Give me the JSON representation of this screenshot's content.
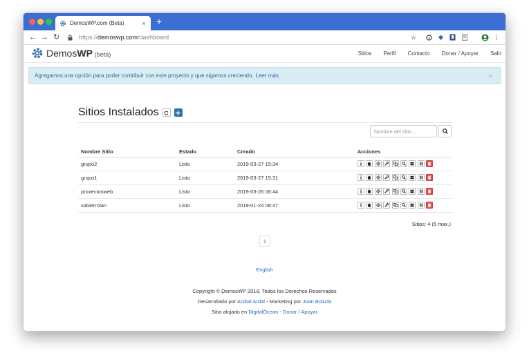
{
  "browser": {
    "tab_title": "DemosWP.com (Beta)",
    "tab_close": "×",
    "new_tab": "+",
    "url_prefix": "https://",
    "url_host": "demoswp.com",
    "url_path": "/dashboard"
  },
  "site": {
    "brand_light": "Demos",
    "brand_bold": "WP",
    "brand_suffix": "(beta)",
    "nav": [
      "Sitios",
      "Perfil",
      "Contacto",
      "Donar / Apoyar",
      "Salir"
    ]
  },
  "alert": {
    "text": "Agregamos una opción para poder contribuir con este proyecto y que sigamos creciendo.",
    "link": "Leer más",
    "close": "×"
  },
  "main": {
    "title": "Sitios Instalados",
    "search_placeholder": "Nombre del sitio...",
    "table": {
      "headers": [
        "Nombre Sitio",
        "Estado",
        "Creado",
        "Acciones"
      ],
      "rows": [
        {
          "name": "grupo2",
          "status": "Listo",
          "created": "2019-03-27 15:34"
        },
        {
          "name": "grupo1",
          "status": "Listo",
          "created": "2019-03-27 15:31"
        },
        {
          "name": "proxectosweb",
          "status": "Listo",
          "created": "2019-03-26 06:44"
        },
        {
          "name": "xabierrolan",
          "status": "Listo",
          "created": "2019-01-24 08:47"
        }
      ]
    },
    "count": "Sitios: 4 (5 max.)",
    "page": "1"
  },
  "footer": {
    "language": "English",
    "copyright": "Copyright © DemosWP 2018. Todos los Derechos Reservados",
    "dev_prefix": "Desarrollado por",
    "dev_name": "Anibal Ardid",
    "marketing_prefix": "- Marketing por",
    "marketing_name": "Joan Boluda",
    "hosted_prefix": "Sitio alojado en",
    "host_name": "DigitalOcean",
    "sep": "-",
    "donate": "Donar / Apoyar"
  },
  "colors": {
    "tabstrip": "#3c6fd3",
    "brand": "#2f6fb1",
    "alert_bg": "#d9ecf4",
    "danger": "#d9534f",
    "link": "#2a6bb8"
  },
  "icons": [
    "info-icon",
    "home-icon",
    "settings-icon",
    "wrench-icon",
    "copy-icon",
    "search-icon",
    "database-icon",
    "pause-icon",
    "trash-icon"
  ]
}
